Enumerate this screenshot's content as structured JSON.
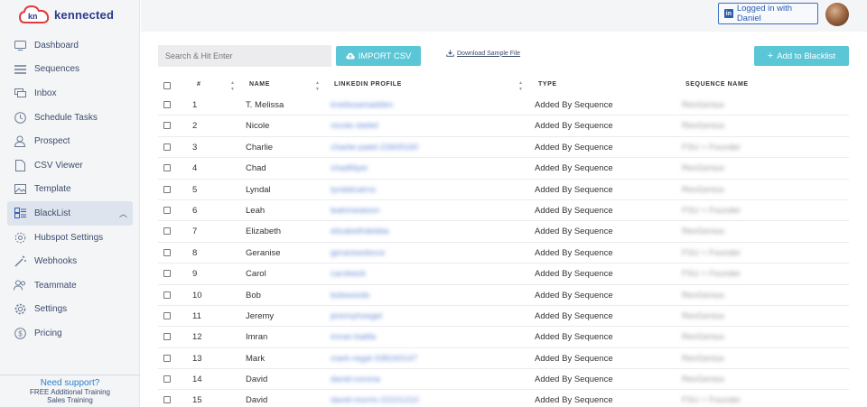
{
  "brand": {
    "name": "kennected",
    "mark": "kn"
  },
  "colors": {
    "accent": "#5bc6d6",
    "link": "#2d7fc8",
    "brand": "#2b3a8c"
  },
  "sidebar": {
    "items": [
      {
        "label": "Dashboard",
        "icon": "monitor-icon"
      },
      {
        "label": "Sequences",
        "icon": "list-icon"
      },
      {
        "label": "Inbox",
        "icon": "chat-icon"
      },
      {
        "label": "Schedule Tasks",
        "icon": "clock-icon"
      },
      {
        "label": "Prospect",
        "icon": "user-icon"
      },
      {
        "label": "CSV Viewer",
        "icon": "file-icon"
      },
      {
        "label": "Template",
        "icon": "image-icon"
      },
      {
        "label": "BlackList",
        "icon": "grid-icon",
        "active": true
      },
      {
        "label": "Hubspot Settings",
        "icon": "cog-icon"
      },
      {
        "label": "Webhooks",
        "icon": "wand-icon"
      },
      {
        "label": "Teammate",
        "icon": "team-icon"
      },
      {
        "label": "Settings",
        "icon": "gear-icon"
      },
      {
        "label": "Pricing",
        "icon": "dollar-icon"
      }
    ],
    "support": {
      "title": "Need support?",
      "line1": "FREE Additional Training",
      "line2": "Sales Training"
    }
  },
  "header": {
    "login_label": "Logged in with Daniel",
    "login_icon": "linkedin-icon"
  },
  "toolbar": {
    "search_placeholder": "Search & Hit Enter",
    "import_label": "IMPORT CSV",
    "download_label": "Download Sample File",
    "add_label": "Add to Blacklist"
  },
  "table": {
    "columns": {
      "num": "#",
      "name": "NAME",
      "linkedin": "LINKEDIN PROFILE",
      "type": "TYPE",
      "sequence": "SEQUENCE NAME"
    },
    "rows": [
      {
        "num": "1",
        "name": "T. Melissa",
        "linkedin": "tmelissamadden",
        "type": "Added By Sequence",
        "sequence": "RevGenius"
      },
      {
        "num": "2",
        "name": "Nicole",
        "linkedin": "nicole-steitel",
        "type": "Added By Sequence",
        "sequence": "RevGenius"
      },
      {
        "num": "3",
        "name": "Charlie",
        "linkedin": "charlie-patel-22609160",
        "type": "Added By Sequence",
        "sequence": "FSU + Founder"
      },
      {
        "num": "4",
        "name": "Chad",
        "linkedin": "chadfdyer",
        "type": "Added By Sequence",
        "sequence": "RevGenius"
      },
      {
        "num": "5",
        "name": "Lyndal",
        "linkedin": "lyndalcairns",
        "type": "Added By Sequence",
        "sequence": "RevGenius"
      },
      {
        "num": "6",
        "name": "Leah",
        "linkedin": "leahmeatson",
        "type": "Added By Sequence",
        "sequence": "FSU + Founder"
      },
      {
        "num": "7",
        "name": "Elizabeth",
        "linkedin": "elizabethdebba",
        "type": "Added By Sequence",
        "sequence": "RevGenius"
      },
      {
        "num": "8",
        "name": "Geranise",
        "linkedin": "geranisedorce",
        "type": "Added By Sequence",
        "sequence": "FSU + Founder"
      },
      {
        "num": "9",
        "name": "Carol",
        "linkedin": "carolwick",
        "type": "Added By Sequence",
        "sequence": "FSU + Founder"
      },
      {
        "num": "10",
        "name": "Bob",
        "linkedin": "bobwoods",
        "type": "Added By Sequence",
        "sequence": "RevGenius"
      },
      {
        "num": "11",
        "name": "Jeremy",
        "linkedin": "jeremyhoegel",
        "type": "Added By Sequence",
        "sequence": "RevGenius"
      },
      {
        "num": "12",
        "name": "Imran",
        "linkedin": "imran-battla",
        "type": "Added By Sequence",
        "sequence": "RevGenius"
      },
      {
        "num": "13",
        "name": "Mark",
        "linkedin": "mark-regal-338160147",
        "type": "Added By Sequence",
        "sequence": "RevGenius"
      },
      {
        "num": "14",
        "name": "David",
        "linkedin": "david-corona",
        "type": "Added By Sequence",
        "sequence": "RevGenius"
      },
      {
        "num": "15",
        "name": "David",
        "linkedin": "david-morris-22101210",
        "type": "Added By Sequence",
        "sequence": "FSU + Founder"
      }
    ]
  }
}
